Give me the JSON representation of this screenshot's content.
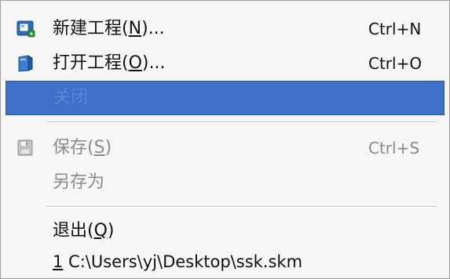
{
  "menu": {
    "items": [
      {
        "label": "新建工程(N)...",
        "mnemonic": "N",
        "shortcut": "Ctrl+N",
        "icon": "new-project-icon",
        "enabled": true
      },
      {
        "label": "打开工程(O)...",
        "mnemonic": "O",
        "shortcut": "Ctrl+O",
        "icon": "open-project-icon",
        "enabled": true
      },
      {
        "label": "关闭",
        "shortcut": "",
        "icon": "",
        "enabled": false,
        "highlighted": true
      },
      {
        "label": "保存(S)",
        "mnemonic": "S",
        "shortcut": "Ctrl+S",
        "icon": "floppy-disk-icon",
        "enabled": false
      },
      {
        "label": "另存为",
        "shortcut": "",
        "icon": "",
        "enabled": false
      },
      {
        "label": "退出(Q)",
        "mnemonic": "Q",
        "shortcut": "",
        "icon": "",
        "enabled": true
      },
      {
        "label": "1 C:\\Users\\yj\\Desktop\\ssk.skm",
        "mnemonic": "1",
        "shortcut": "",
        "icon": "",
        "enabled": true
      }
    ]
  },
  "colors": {
    "highlight": "#3f6fc8",
    "disabled_text": "#8a8a8a",
    "menu_bg": "#f6f6f6"
  }
}
